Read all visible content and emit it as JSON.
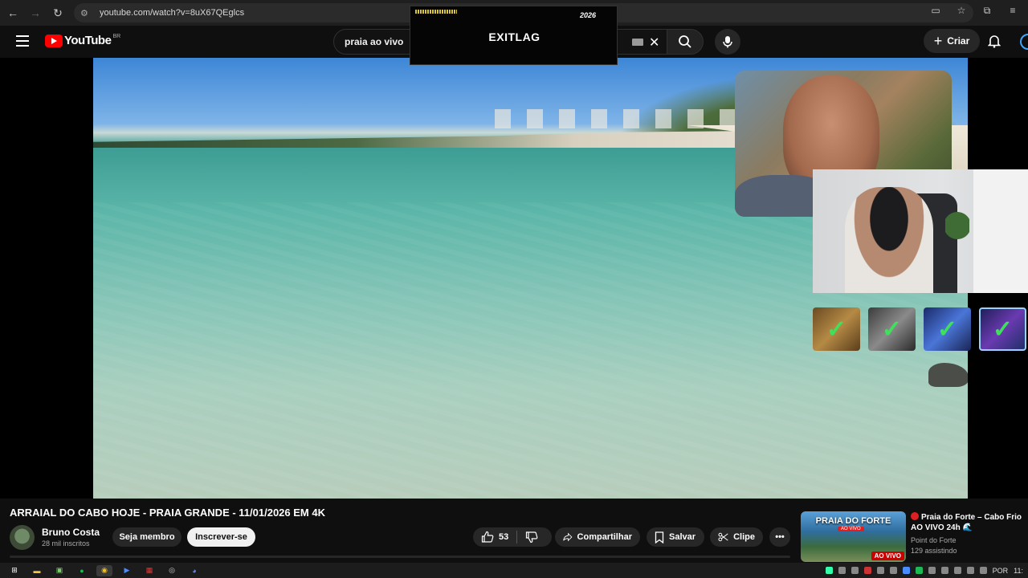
{
  "browser": {
    "url": "youtube.com/watch?v=8uX67QEglcs",
    "back_icon": "←",
    "forward_icon": "→",
    "reload_icon": "↻"
  },
  "header": {
    "logo_word": "YouTube",
    "region": "BR",
    "search_value": "praia ao vivo",
    "create_label": "Criar"
  },
  "overlay": {
    "brand": "EXITLAG",
    "year": "2026"
  },
  "video": {
    "title": "ARRAIAL DO CABO HOJE - PRAIA GRANDE - 11/01/2026 EM 4K",
    "channel": "Bruno Costa",
    "subscribers": "28 mil inscritos",
    "member_label": "Seja membro",
    "subscribe_label": "Inscrever-se",
    "likes": "53",
    "share_label": "Compartilhar",
    "save_label": "Salvar",
    "clip_label": "Clipe"
  },
  "recommendation": {
    "thumb_title": "PRAIA DO FORTE",
    "thumb_sub": "AO VIVO",
    "thumb_badge": "AO VIVO",
    "title": "Praia do Forte – Cabo Frio AO VIVO 24h 🌊",
    "channel": "Point do Forte",
    "viewers": "129 assistindo"
  },
  "tiles": [
    "✓",
    "✓",
    "✓",
    "✓"
  ],
  "taskbar": {
    "lang": "POR",
    "time": "11:"
  },
  "colors": {
    "yt_red": "#ff0000",
    "bg": "#0f0f0f",
    "live_red": "#cc0000"
  }
}
